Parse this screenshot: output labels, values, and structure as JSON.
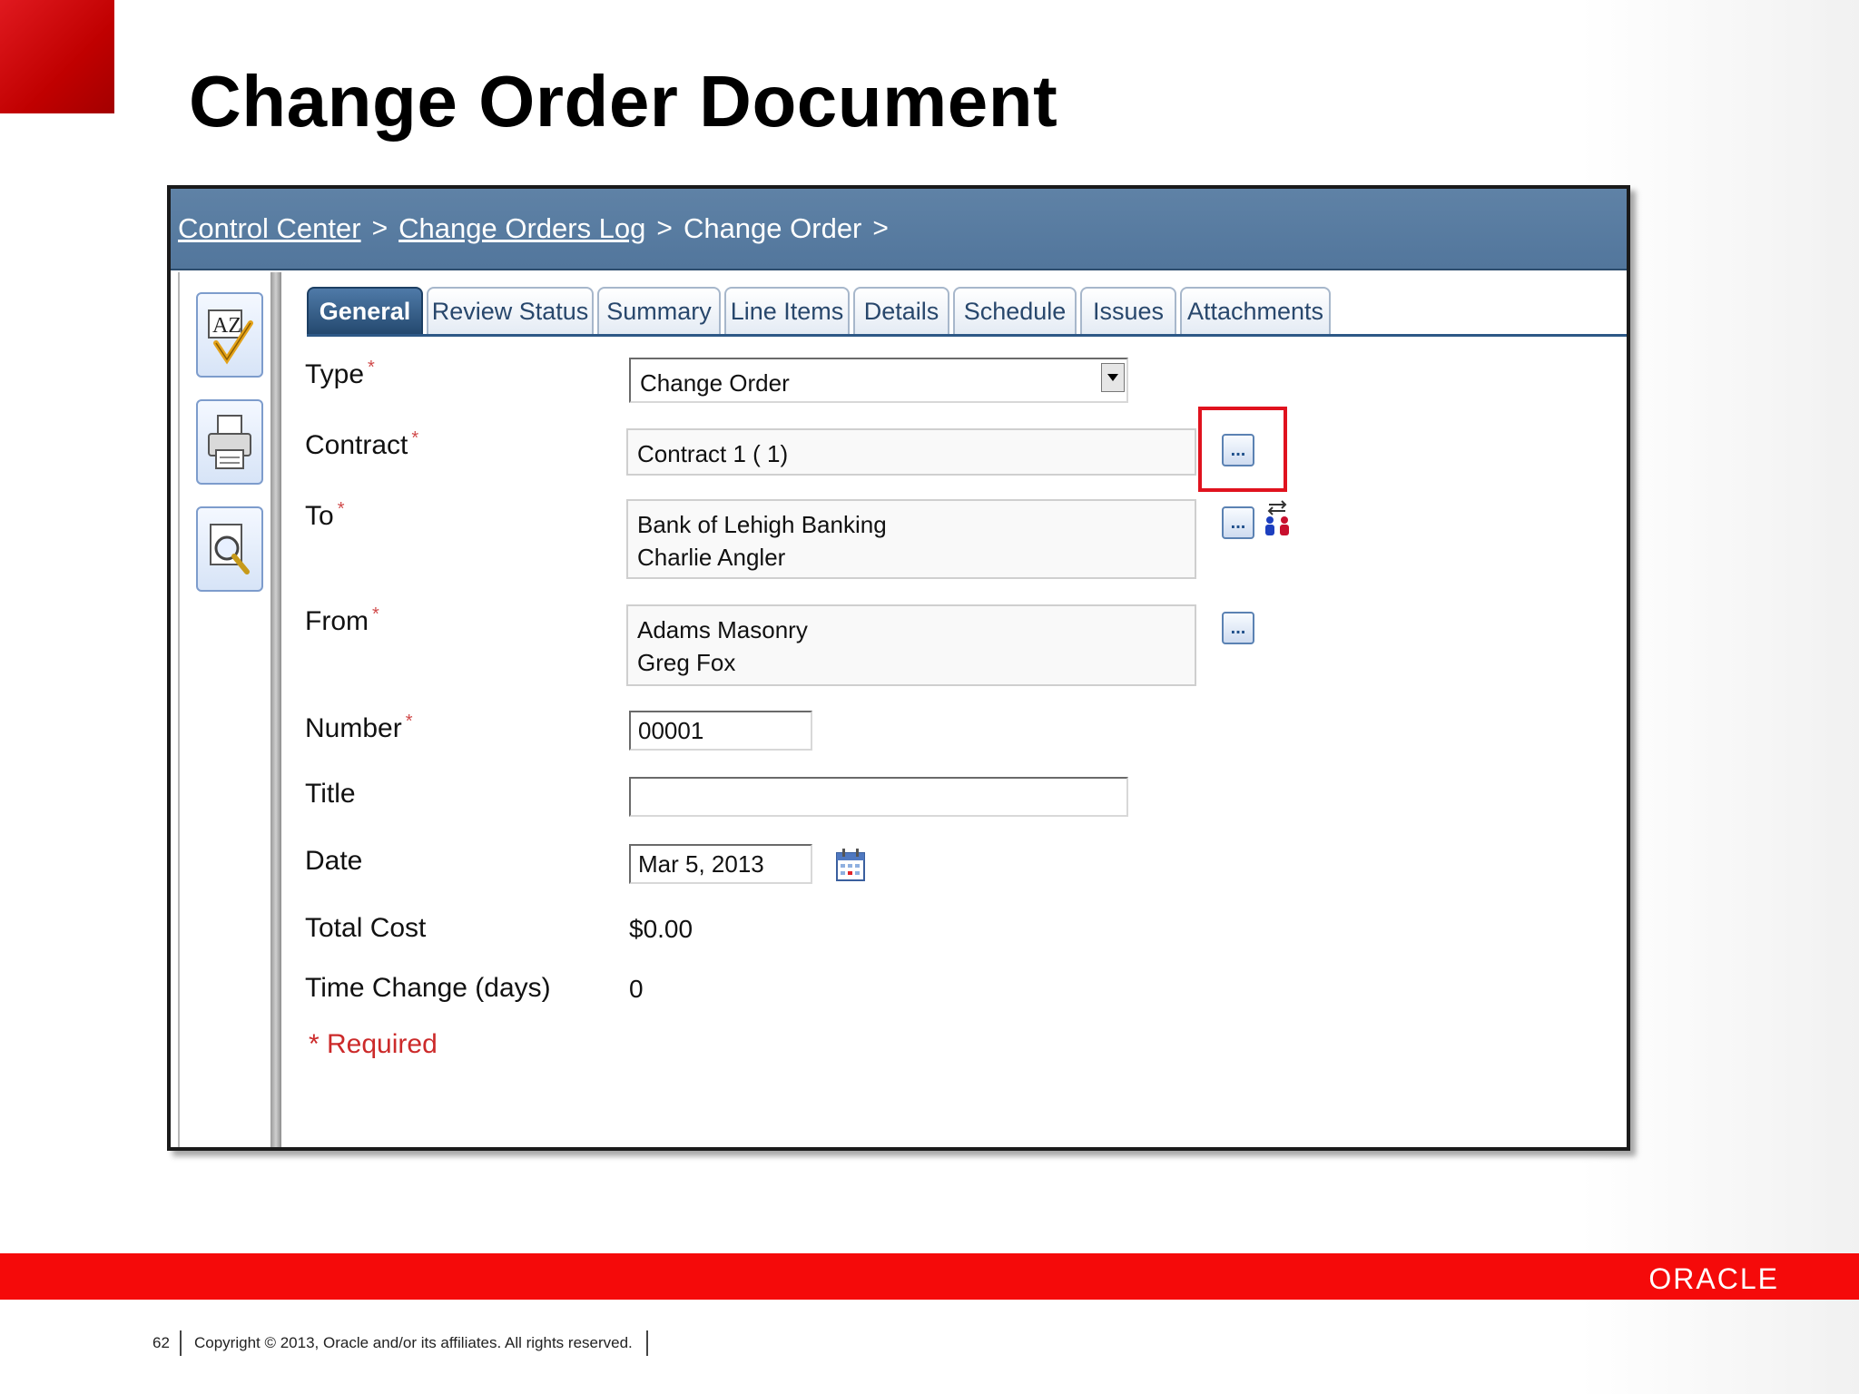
{
  "slide": {
    "title": "Change Order Document",
    "page_number": "62",
    "copyright": "Copyright © 2013, Oracle and/or its affiliates. All rights reserved.",
    "brand": "ORACLE"
  },
  "breadcrumb": {
    "items": [
      {
        "label": "Control Center",
        "link": true
      },
      {
        "label": "Change Orders Log",
        "link": true
      },
      {
        "label": "Change Order",
        "link": false
      }
    ],
    "separator": ">"
  },
  "toolbar": {
    "buttons": [
      {
        "name": "spell-check",
        "icon": "spell-check-az-icon"
      },
      {
        "name": "print",
        "icon": "printer-icon"
      },
      {
        "name": "print-preview",
        "icon": "magnifier-document-icon"
      }
    ]
  },
  "tabs": [
    {
      "label": "General",
      "active": true
    },
    {
      "label": "Review Status",
      "active": false
    },
    {
      "label": "Summary",
      "active": false
    },
    {
      "label": "Line Items",
      "active": false
    },
    {
      "label": "Details",
      "active": false
    },
    {
      "label": "Schedule",
      "active": false
    },
    {
      "label": "Issues",
      "active": false
    },
    {
      "label": "Attachments",
      "active": false
    }
  ],
  "form": {
    "type": {
      "label": "Type",
      "required_mark": "*",
      "value": "Change Order"
    },
    "contract": {
      "label": "Contract",
      "required_mark": "*",
      "value": "Contract 1 ( 1)",
      "lookup_label": "..."
    },
    "to": {
      "label": "To",
      "required_mark": "*",
      "line1": "Bank of Lehigh Banking",
      "line2": "Charlie Angler",
      "lookup_label": "..."
    },
    "from": {
      "label": "From",
      "required_mark": "*",
      "line1": "Adams Masonry",
      "line2": "Greg Fox",
      "lookup_label": "..."
    },
    "number": {
      "label": "Number",
      "required_mark": "*",
      "value": "00001"
    },
    "title": {
      "label": "Title",
      "value": ""
    },
    "date": {
      "label": "Date",
      "value": "Mar 5, 2013"
    },
    "total_cost": {
      "label": "Total Cost",
      "value": "$0.00"
    },
    "time_change": {
      "label": "Time Change (days)",
      "value": "0"
    },
    "required_note": "* Required"
  },
  "colors": {
    "accent_red": "#f50a0a",
    "header_blue": "#5f82a6",
    "tab_active": "#24496f",
    "highlight": "#e0121e"
  }
}
